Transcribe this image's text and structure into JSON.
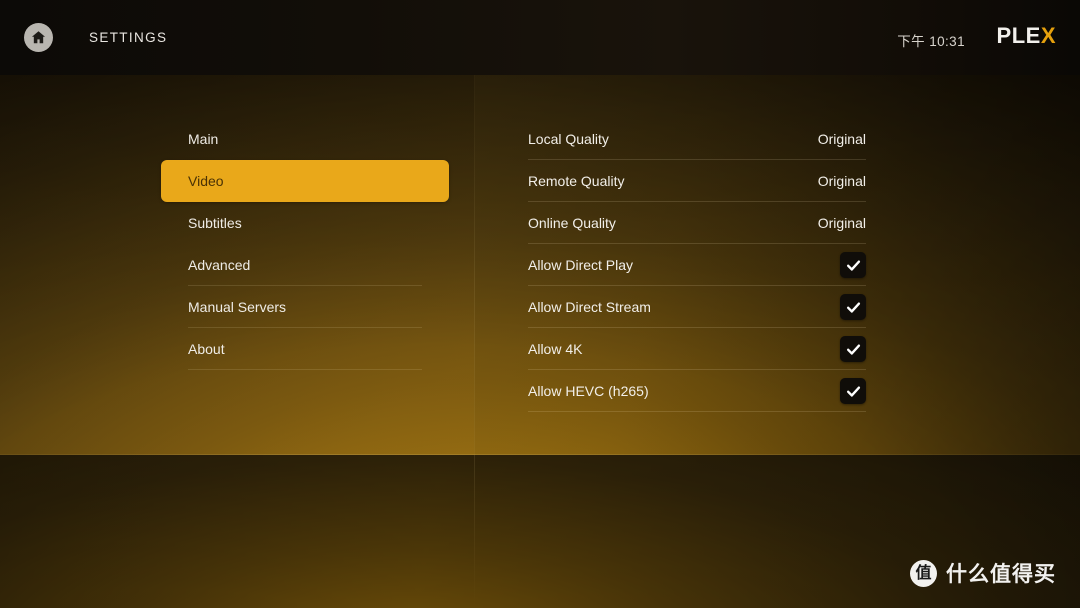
{
  "header": {
    "home_icon": "home-icon",
    "title": "SETTINGS",
    "clock": "下午 10:31",
    "logo_main": "PLE",
    "logo_accent": "X"
  },
  "sidebar": {
    "items": [
      {
        "label": "Main",
        "active": false
      },
      {
        "label": "Video",
        "active": true
      },
      {
        "label": "Subtitles",
        "active": false
      },
      {
        "label": "Advanced",
        "active": false
      },
      {
        "label": "Manual Servers",
        "active": false
      },
      {
        "label": "About",
        "active": false
      }
    ]
  },
  "main": {
    "rows": [
      {
        "label": "Local Quality",
        "type": "value",
        "value": "Original"
      },
      {
        "label": "Remote Quality",
        "type": "value",
        "value": "Original"
      },
      {
        "label": "Online Quality",
        "type": "value",
        "value": "Original"
      },
      {
        "label": "Allow Direct Play",
        "type": "checkbox",
        "checked": true
      },
      {
        "label": "Allow Direct Stream",
        "type": "checkbox",
        "checked": true
      },
      {
        "label": "Allow 4K",
        "type": "checkbox",
        "checked": true
      },
      {
        "label": "Allow HEVC (h265)",
        "type": "checkbox",
        "checked": true
      }
    ]
  },
  "watermark": {
    "badge": "值",
    "text": "什么值得买"
  },
  "colors": {
    "accent": "#e9a81a",
    "logo_accent": "#e5a00d",
    "text": "#efece6",
    "active_text": "#4a3205",
    "checkbox_bg": "#100d09",
    "header_bg": "#120e08"
  }
}
